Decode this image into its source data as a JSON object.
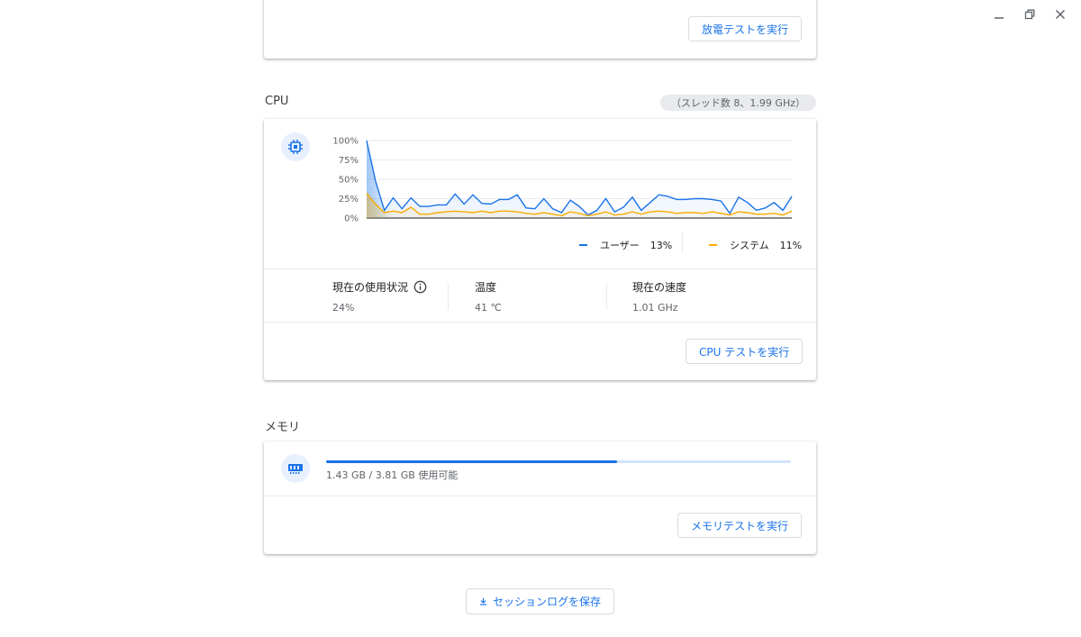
{
  "window": {
    "minimize_icon": "minimize-icon",
    "restore_icon": "restore-icon",
    "close_icon": "close-icon"
  },
  "battery": {
    "discharge_button": "放電テストを実行"
  },
  "cpu": {
    "title": "CPU",
    "info_chip": "（スレッド数 8、1.99 GHz）",
    "legend": {
      "user_label": "ユーザー",
      "user_value": "13%",
      "system_label": "システム",
      "system_value": "11%"
    },
    "stats": {
      "usage_label": "現在の使用状況",
      "usage_value": "24%",
      "temp_label": "温度",
      "temp_value": "41 ℃",
      "speed_label": "現在の速度",
      "speed_value": "1.01 GHz"
    },
    "test_button": "CPU テストを実行"
  },
  "chart_data": {
    "type": "area",
    "ylim": [
      0,
      100
    ],
    "y_ticks": [
      "100%",
      "75%",
      "50%",
      "25%",
      "0%"
    ],
    "series": [
      {
        "name": "ユーザー",
        "color": "#1a73e8",
        "values": [
          100,
          48,
          10,
          26,
          12,
          26,
          15,
          15,
          17,
          17,
          31,
          18,
          30,
          19,
          18,
          24,
          24,
          30,
          13,
          12,
          25,
          12,
          7,
          23,
          15,
          4,
          10,
          25,
          8,
          14,
          27,
          10,
          20,
          30,
          28,
          24,
          24,
          25,
          25,
          24,
          22,
          6,
          27,
          20,
          10,
          13,
          20,
          10,
          28
        ]
      },
      {
        "name": "システム",
        "color": "#f9ab00",
        "values": [
          32,
          18,
          7,
          9,
          7,
          14,
          5,
          5,
          7,
          8,
          9,
          8,
          7,
          9,
          7,
          9,
          9,
          8,
          6,
          5,
          7,
          5,
          3,
          8,
          6,
          3,
          5,
          8,
          4,
          5,
          8,
          5,
          8,
          9,
          8,
          6,
          7,
          7,
          6,
          8,
          6,
          4,
          8,
          7,
          5,
          5,
          6,
          4,
          9
        ]
      }
    ]
  },
  "memory": {
    "title": "メモリ",
    "usage_text": "1.43 GB / 3.81 GB 使用可能",
    "used_fraction": 0.625,
    "test_button": "メモリテストを実行"
  },
  "footer": {
    "save_log_button": "セッションログを保存"
  },
  "colors": {
    "accent": "#1a73e8",
    "system": "#f9ab00",
    "track": "#d2e3fc"
  }
}
